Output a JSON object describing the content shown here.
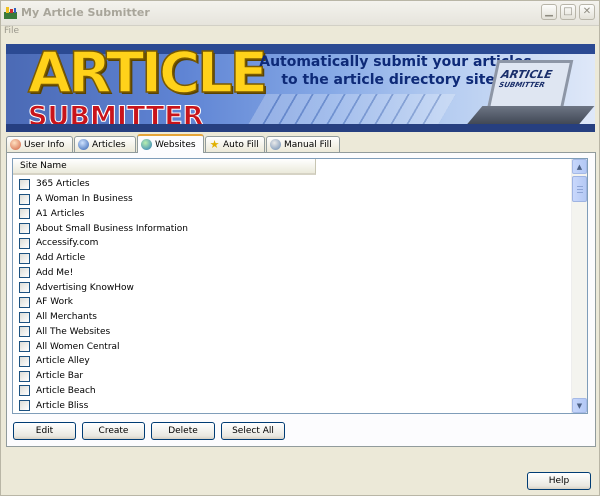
{
  "window": {
    "title": "My Article Submitter",
    "min_glyph": "▁",
    "max_glyph": "□",
    "close_glyph": "✕"
  },
  "menu": {
    "file_label": "File"
  },
  "banner": {
    "logo_line1": "ARTICLE",
    "logo_line2": "SUBMITTER",
    "tagline_line1": "Automatically submit your articles",
    "tagline_line2": "to the article directory sites!",
    "mini_logo_line1": "ARTICLE",
    "mini_logo_line2": "SUBMITTER"
  },
  "tabs": [
    {
      "label": "User Info",
      "icon": "user-info-icon",
      "active": false
    },
    {
      "label": "Articles",
      "icon": "articles-icon",
      "active": false
    },
    {
      "label": "Websites",
      "icon": "websites-icon",
      "active": true
    },
    {
      "label": "Auto Fill",
      "icon": "star-icon",
      "active": false
    },
    {
      "label": "Manual Fill",
      "icon": "manual-fill-icon",
      "active": false
    }
  ],
  "list": {
    "column_header": "Site Name",
    "items": [
      "365 Articles",
      "A Woman In Business",
      "A1 Articles",
      "About Small Business Information",
      "Accessify.com",
      "Add Article",
      "Add Me!",
      "Advertising KnowHow",
      "AF Work",
      "All Merchants",
      "All The Websites",
      "All Women Central",
      "Article Alley",
      "Article Bar",
      "Article Beach",
      "Article Bliss"
    ]
  },
  "buttons": {
    "edit": "Edit",
    "create": "Create",
    "delete": "Delete",
    "select_all": "Select All",
    "help": "Help"
  },
  "colors": {
    "accent": "#e6a53a",
    "button_border": "#003c74",
    "logo_yellow": "#ffd21a",
    "logo_red": "#c8141b"
  }
}
